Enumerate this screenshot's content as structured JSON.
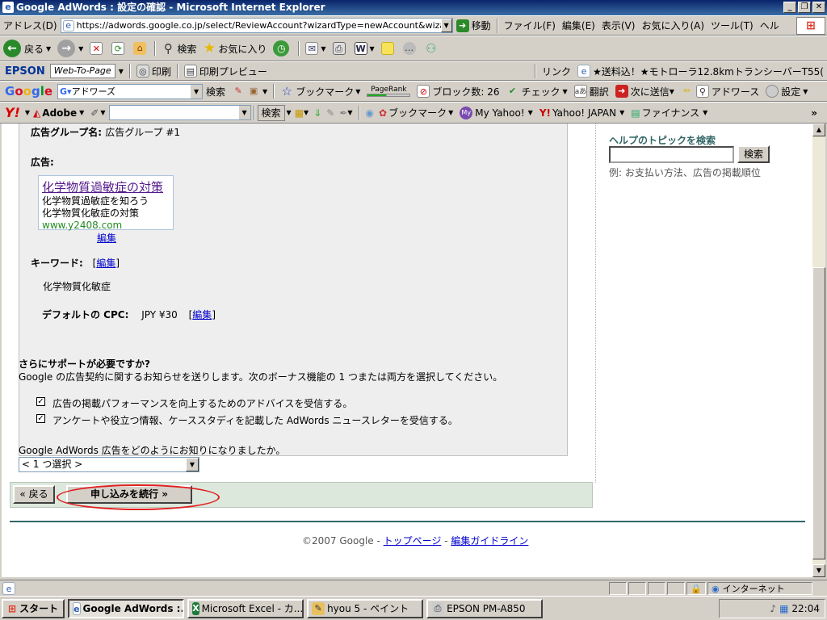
{
  "window": {
    "title": "Google AdWords : 設定の確認 - Microsoft Internet Explorer",
    "min": "_",
    "max": "❐",
    "close": "✕"
  },
  "addressbar": {
    "label": "アドレス(D)",
    "url": "https://adwords.google.co.jp/select/ReviewAccount?wizardType=newAccount&wizardKe",
    "go": "移動"
  },
  "menu": [
    "ファイル(F)",
    "編集(E)",
    "表示(V)",
    "お気に入り(A)",
    "ツール(T)",
    "ヘル"
  ],
  "navbar": {
    "back": "戻る",
    "search": "検索",
    "favorites": "お気に入り"
  },
  "epsonbar": {
    "logo": "EPSON",
    "webtopage": "Web-To-Page",
    "print": "印刷",
    "preview": "印刷プレビュー",
    "links_label": "リンク",
    "link1": "★送料込！★モトローラ12.8kmトランシーバーT55("
  },
  "googlebar": {
    "logo": "Google",
    "query": "アドワーズ",
    "search": "検索",
    "bookmark": "ブックマーク",
    "pagerank": "PageRank",
    "blocked": "ブロック数: 26",
    "check": "チェック",
    "translate": "翻訳",
    "sendto": "次に送信",
    "adwords": "アドワース",
    "settings": "設定"
  },
  "yahoobar": {
    "logo": "Y!",
    "adobe": "Adobe",
    "search": "検索",
    "bookmark": "ブックマーク",
    "myyahoo": "My Yahoo!",
    "yahoojapan": "Yahoo! JAPAN",
    "finance": "ファイナンス"
  },
  "adgroup": {
    "name_label": "広告グループ名:",
    "name_value": "広告グループ #1",
    "ad_label": "広告:",
    "ad": {
      "title": "化学物質過敏症の対策",
      "line1": "化学物質過敏症を知ろう",
      "line2": "化学物質化敏症の対策",
      "url": "www.y2408.com"
    },
    "edit": "編集",
    "keyword_label": "キーワード:",
    "keyword_edit": "編集",
    "keyword_value": "化学物質化敏症",
    "cpc_label": "デフォルトの CPC:",
    "cpc_value": "JPY ¥30",
    "cpc_edit": "編集"
  },
  "help": {
    "title": "ヘルプのトピックを検索",
    "button": "検索",
    "example": "例: お支払い方法、広告の掲載順位"
  },
  "support": {
    "heading": "さらにサポートが必要ですか?",
    "description": "Google の広告契約に関するお知らせを送りします。次のボーナス機能の 1 つまたは両方を選択してください。",
    "option1": "広告の掲載パフォーマンスを向上するためのアドバイスを受信する。",
    "option2": "アンケートや役立つ情報、ケーススタディを記載した AdWords ニュースレターを受信する。",
    "option1_checked": true,
    "option2_checked": true
  },
  "referral": {
    "question": "Google AdWords 広告をどのようにお知りになりましたか。",
    "selected": "< 1 つ選択 >"
  },
  "actions": {
    "back": "« 戻る",
    "continue": "申し込みを続行 »"
  },
  "footer": {
    "copyright": "©2007 Google",
    "dash": " - ",
    "top": "トップページ",
    "guidelines": "編集ガイドライン"
  },
  "statusbar": {
    "zone": "インターネット"
  },
  "taskbar": {
    "start": "スタート",
    "tasks": [
      "Google AdWords :...",
      "Microsoft Excel - カ...",
      "hyou  5 - ペイント",
      "EPSON PM-A850"
    ],
    "time": "22:04"
  },
  "colors": {
    "link": "#0000cc",
    "visited": "#551a8b",
    "adurl": "#228b22",
    "helptitle": "#336666",
    "highlight_oval": "#e02020"
  }
}
